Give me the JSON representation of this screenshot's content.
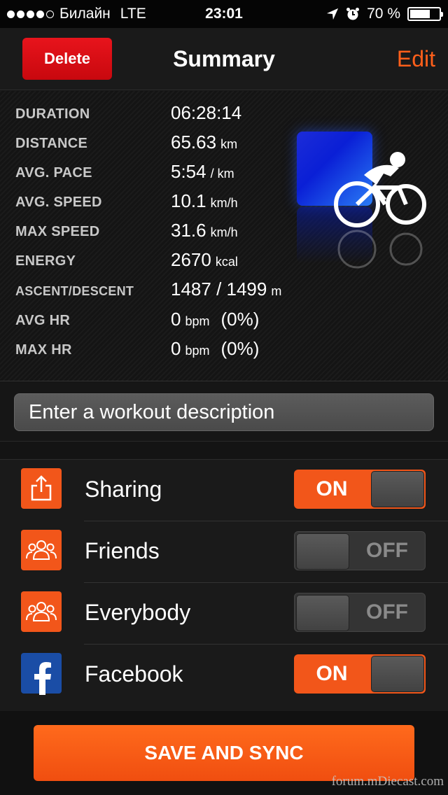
{
  "status_bar": {
    "carrier": "Билайн",
    "network": "LTE",
    "time": "23:01",
    "battery": "70 %",
    "battery_level": 0.7
  },
  "nav": {
    "delete_label": "Delete",
    "title": "Summary",
    "edit_label": "Edit"
  },
  "stats": [
    {
      "label": "DURATION",
      "value": "06:28:14",
      "unit": "",
      "extra": ""
    },
    {
      "label": "DISTANCE",
      "value": "65.63",
      "unit": "km",
      "extra": ""
    },
    {
      "label": "AVG. PACE",
      "value": "5:54",
      "unit": "/ km",
      "extra": ""
    },
    {
      "label": "AVG. SPEED",
      "value": "10.1",
      "unit": "km/h",
      "extra": ""
    },
    {
      "label": "MAX SPEED",
      "value": "31.6",
      "unit": "km/h",
      "extra": ""
    },
    {
      "label": "ENERGY",
      "value": "2670",
      "unit": "kcal",
      "extra": ""
    },
    {
      "label": "ASCENT/DESCENT",
      "value": "1487 / 1499",
      "unit": "m",
      "extra": ""
    },
    {
      "label": "AVG HR",
      "value": "0",
      "unit": "bpm",
      "extra": "(0%)"
    },
    {
      "label": "MAX HR",
      "value": "0",
      "unit": "bpm",
      "extra": "(0%)"
    }
  ],
  "sport_icon": "cycling-icon",
  "description": {
    "placeholder": "Enter a workout description"
  },
  "sharing": [
    {
      "label": "Sharing",
      "icon": "share-icon",
      "state": "ON",
      "on": true
    },
    {
      "label": "Friends",
      "icon": "friends-icon",
      "state": "OFF",
      "on": false
    },
    {
      "label": "Everybody",
      "icon": "everybody-icon",
      "state": "OFF",
      "on": false
    },
    {
      "label": "Facebook",
      "icon": "facebook-icon",
      "state": "ON",
      "on": true
    }
  ],
  "save_label": "SAVE AND SYNC",
  "watermark": "forum.mDiecast.com",
  "colors": {
    "accent": "#f2561a",
    "delete": "#e8141c",
    "facebook": "#1a4da6"
  }
}
